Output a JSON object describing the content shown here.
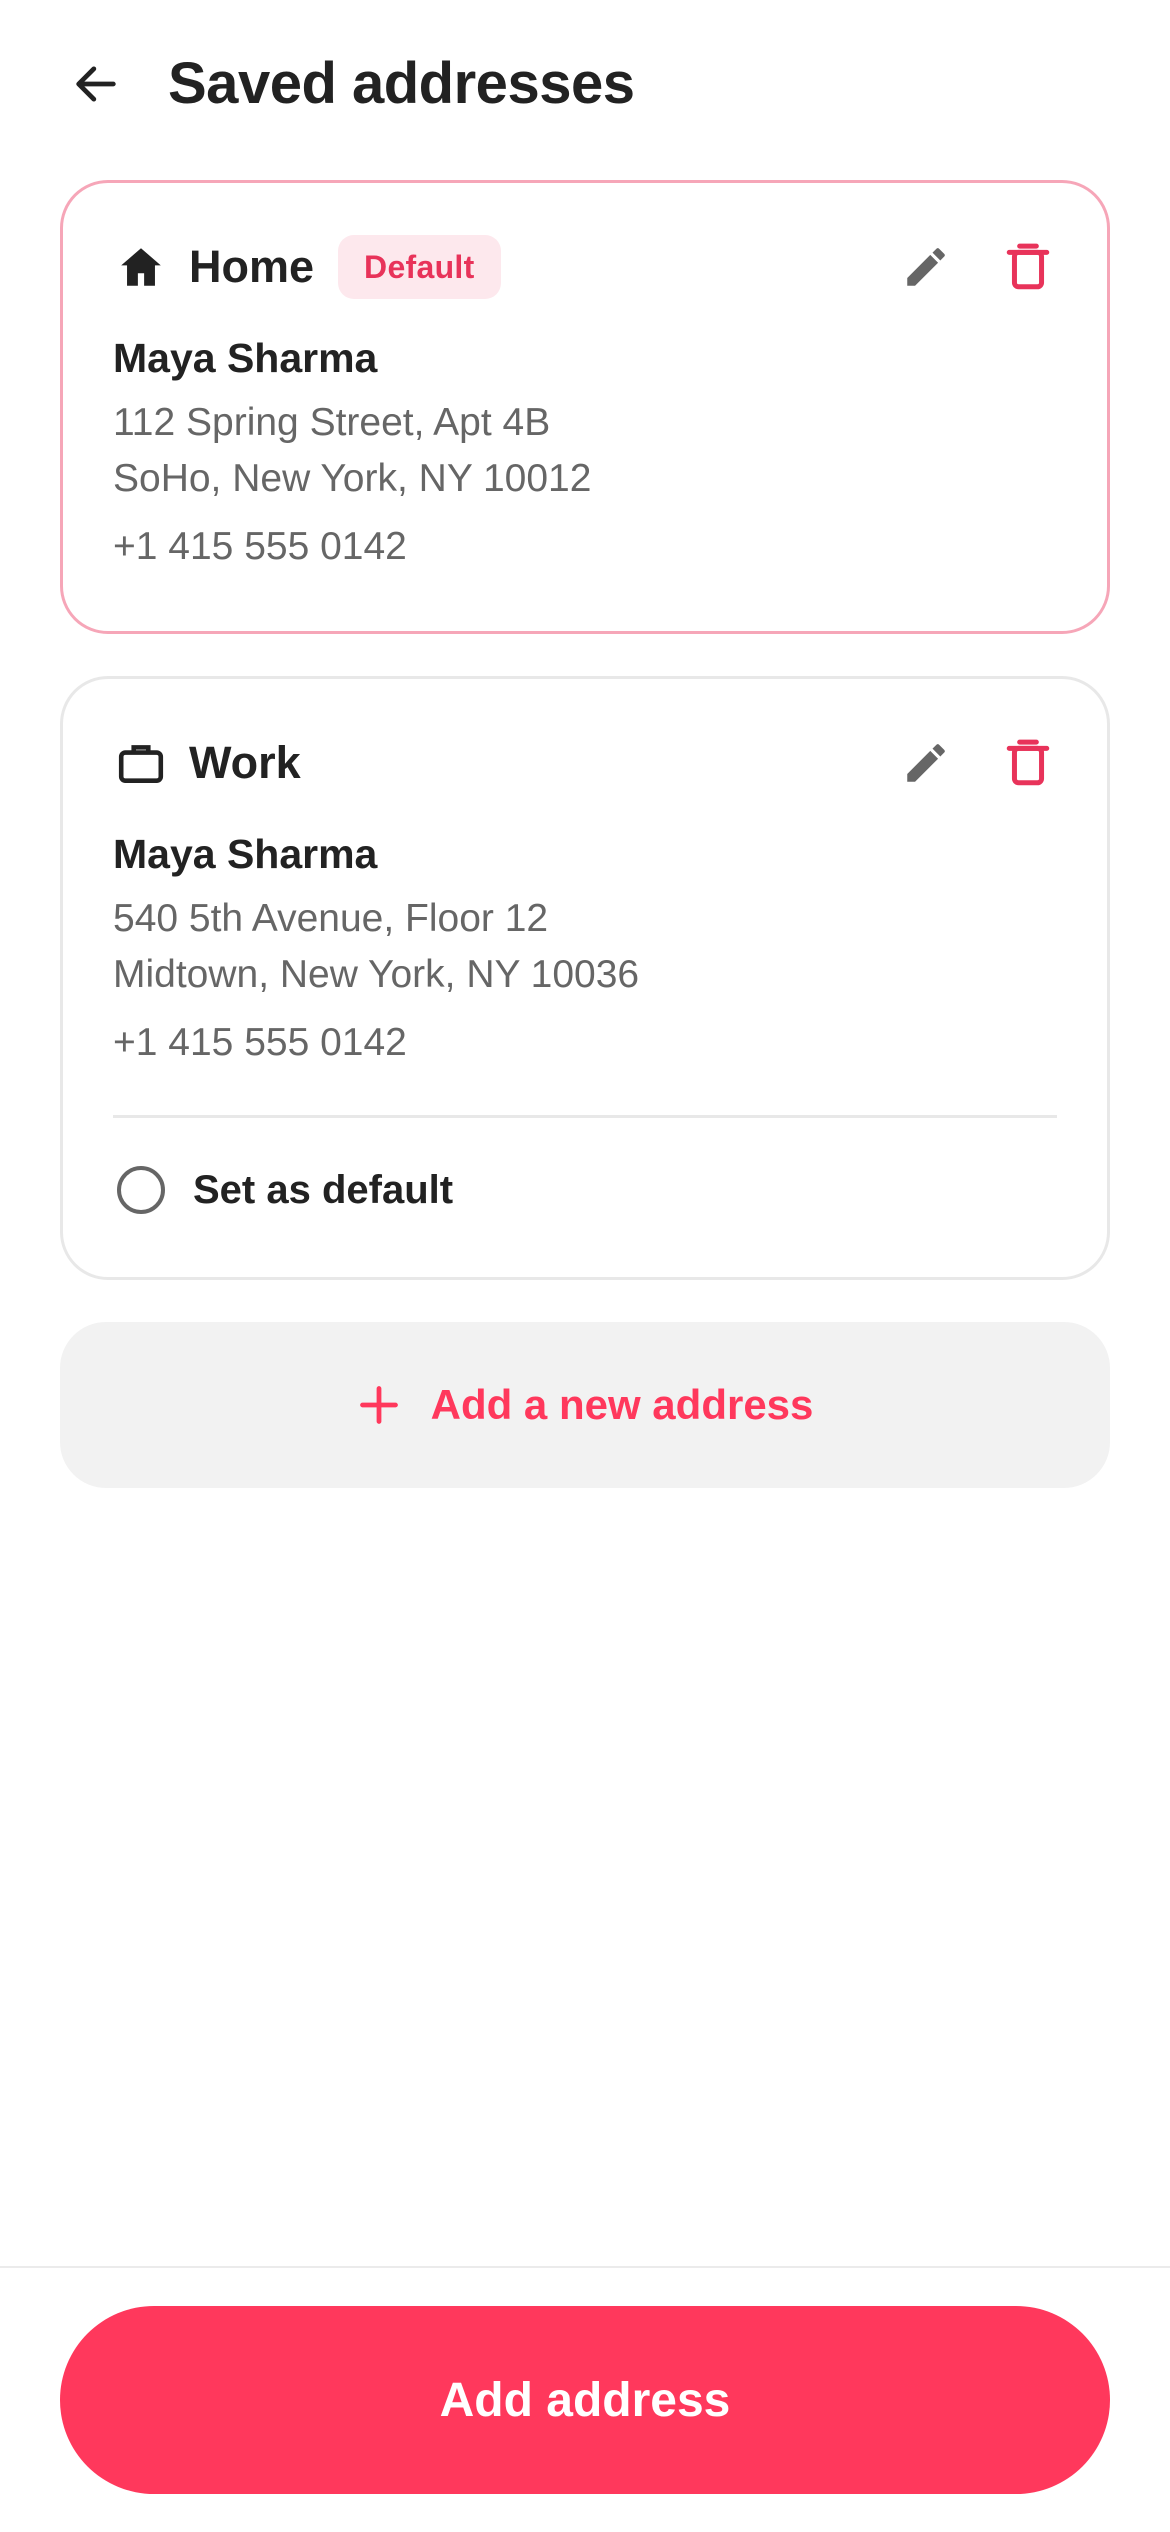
{
  "header": {
    "title": "Saved addresses",
    "back_icon": "arrow-left-icon"
  },
  "addresses": [
    {
      "type_label": "Home",
      "type_icon": "home-icon",
      "is_default": true,
      "badge": "Default",
      "name": "Maya Sharma",
      "line1": "112 Spring Street, Apt 4B",
      "line2": "SoHo, New York, NY 10012",
      "phone": "+1 415 555 0142"
    },
    {
      "type_label": "Work",
      "type_icon": "briefcase-icon",
      "is_default": false,
      "name": "Maya Sharma",
      "line1": "540 5th Avenue, Floor 12",
      "line2": "Midtown, New York, NY 10036",
      "phone": "+1 415 555 0142",
      "set_default_label": "Set as default"
    }
  ],
  "add_new": {
    "label": "Add a new address",
    "icon": "plus-icon"
  },
  "footer": {
    "primary_label": "Add address"
  },
  "colors": {
    "accent": "#ff385c",
    "accent_soft": "#fde8ed",
    "default_border": "#f6a6b8",
    "text_primary": "#222222",
    "text_secondary": "#666666",
    "delete": "#e8335a"
  }
}
